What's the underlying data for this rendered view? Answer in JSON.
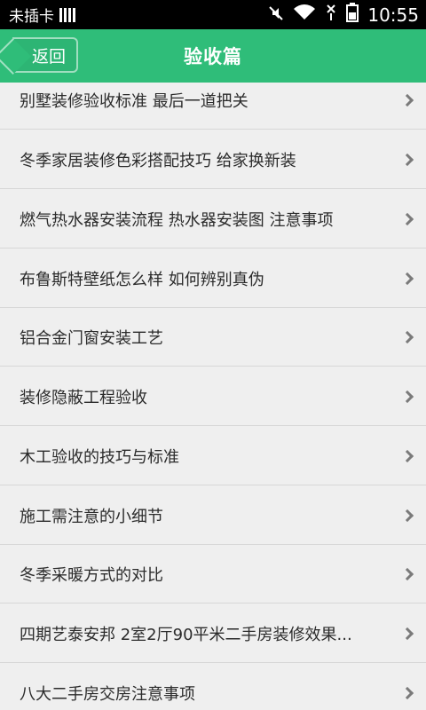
{
  "status_bar": {
    "carrier": "未插卡",
    "time": "10:55",
    "icons": [
      "sim-bars-icon",
      "mute-icon",
      "wifi-icon",
      "no-signal-icon",
      "battery-icon"
    ]
  },
  "header": {
    "back_label": "返回",
    "title": "验收篇",
    "accent_color": "#2fbd79"
  },
  "list": {
    "items": [
      {
        "label": "别墅装修验收标准 最后一道把关"
      },
      {
        "label": "冬季家居装修色彩搭配技巧 给家换新装"
      },
      {
        "label": "燃气热水器安装流程 热水器安装图 注意事项"
      },
      {
        "label": "布鲁斯特壁纸怎么样 如何辨别真伪"
      },
      {
        "label": "铝合金门窗安装工艺"
      },
      {
        "label": "装修隐蔽工程验收"
      },
      {
        "label": "木工验收的技巧与标准"
      },
      {
        "label": "施工需注意的小细节"
      },
      {
        "label": "冬季采暖方式的对比"
      },
      {
        "label": "四期艺泰安邦 2室2厅90平米二手房装修效果..."
      },
      {
        "label": "八大二手房交房注意事项"
      }
    ]
  }
}
